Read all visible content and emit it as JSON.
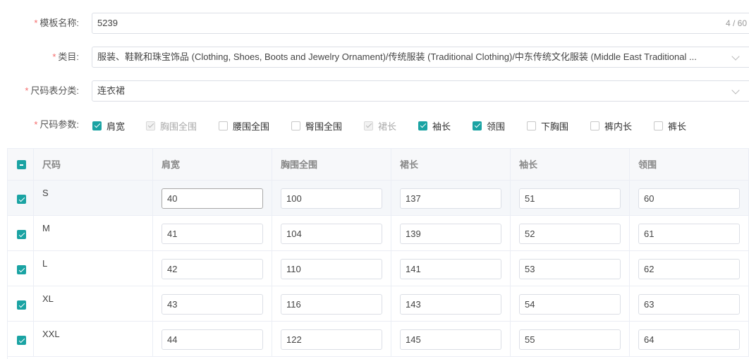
{
  "form": {
    "template_name": {
      "label": "模板名称:",
      "value": "5239",
      "counter": "4 / 60"
    },
    "category": {
      "label": "类目:",
      "value": "服装、鞋靴和珠宝饰品 (Clothing, Shoes, Boots and Jewelry Ornament)/传统服装 (Traditional Clothing)/中东传统文化服装 (Middle East Traditional ..."
    },
    "size_chart_type": {
      "label": "尺码表分类:",
      "value": "连衣裙"
    },
    "size_params": {
      "label": "尺码参数:",
      "options": [
        {
          "label": "肩宽",
          "state": "checked"
        },
        {
          "label": "胸围全围",
          "state": "disabled"
        },
        {
          "label": "腰围全围",
          "state": "unchecked"
        },
        {
          "label": "臀围全围",
          "state": "unchecked"
        },
        {
          "label": "裙长",
          "state": "disabled"
        },
        {
          "label": "袖长",
          "state": "checked"
        },
        {
          "label": "领围",
          "state": "checked"
        },
        {
          "label": "下胸围",
          "state": "unchecked"
        },
        {
          "label": "裤内长",
          "state": "unchecked"
        },
        {
          "label": "裤长",
          "state": "unchecked"
        }
      ]
    }
  },
  "table": {
    "headers": [
      "尺码",
      "肩宽",
      "胸围全围",
      "裙长",
      "袖长",
      "领围"
    ],
    "rows": [
      {
        "size": "S",
        "values": [
          "40",
          "100",
          "137",
          "51",
          "60"
        ]
      },
      {
        "size": "M",
        "values": [
          "41",
          "104",
          "139",
          "52",
          "61"
        ]
      },
      {
        "size": "L",
        "values": [
          "42",
          "110",
          "141",
          "53",
          "62"
        ]
      },
      {
        "size": "XL",
        "values": [
          "43",
          "116",
          "143",
          "54",
          "63"
        ]
      },
      {
        "size": "XXL",
        "values": [
          "44",
          "122",
          "145",
          "55",
          "64"
        ]
      }
    ]
  },
  "colors": {
    "accent": "#1aa3a3",
    "required": "#f56c6c",
    "border": "#dcdfe6"
  }
}
